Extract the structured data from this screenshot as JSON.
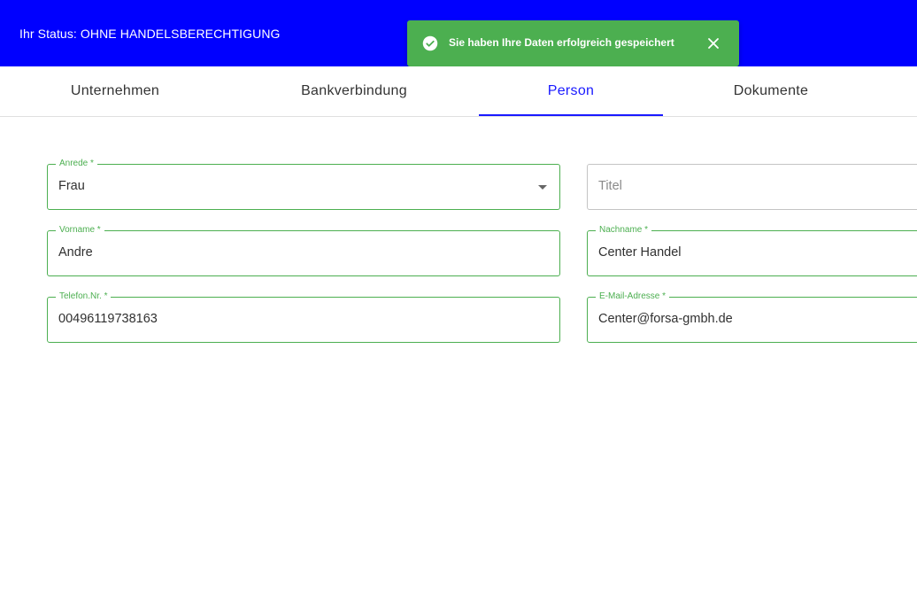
{
  "header": {
    "status_text": "Ihr Status: OHNE HANDELSBERECHTIGUNG",
    "bg_color": "#0000ff"
  },
  "toast": {
    "message": "Sie haben Ihre Daten erfolgreich gespeichert",
    "icon": "check-circle-icon",
    "close_icon": "close-icon",
    "color": "#4caf50"
  },
  "tabs": [
    {
      "label": "Unternehmen"
    },
    {
      "label": "Bankverbindung"
    },
    {
      "label": "Person"
    },
    {
      "label": "Dokumente"
    }
  ],
  "active_tab": "Person",
  "form": {
    "anrede": {
      "label": "Anrede *",
      "value": "Frau"
    },
    "titel": {
      "placeholder": "Titel",
      "value": ""
    },
    "vorname": {
      "label": "Vorname *",
      "value": "Andre"
    },
    "nachname": {
      "label": "Nachname *",
      "value": "Center Handel"
    },
    "telefon": {
      "label": "Telefon.Nr. *",
      "value": "00496119738163"
    },
    "email": {
      "label": "E-Mail-Adresse *",
      "value": "Center@forsa-gmbh.de"
    }
  }
}
